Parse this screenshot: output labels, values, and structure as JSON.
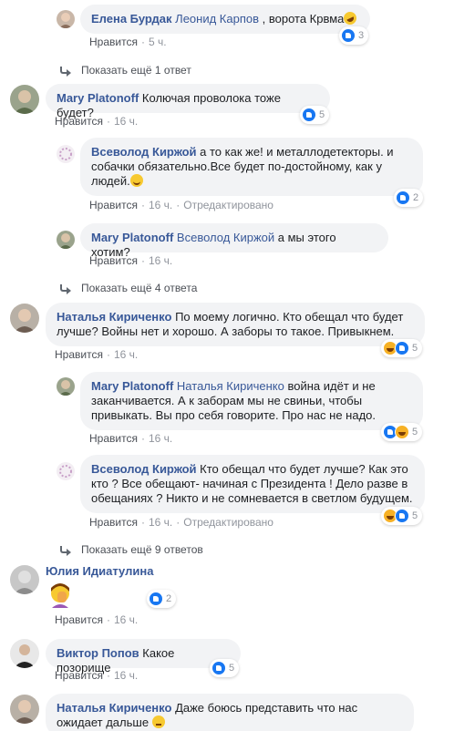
{
  "labels": {
    "like": "Нравится",
    "edited": "Отредактировано",
    "dot": "·"
  },
  "comments": [
    {
      "id": "c1",
      "author": "Елена Бурдак",
      "mention": "Леонид Карпов",
      "text": ", ворота Крвма",
      "emoji": "rofl-emoji",
      "time": "5 ч.",
      "reactions": "3"
    },
    {
      "id": "c2",
      "more": "Показать ещё 1 ответ"
    },
    {
      "id": "c3",
      "author": "Mary Platonoff",
      "text": "Колючая проволока тоже будет?",
      "time": "16 ч.",
      "reactions": "5"
    },
    {
      "id": "c4",
      "author": "Всеволод Киржой",
      "text": "а то как же! и металлодетекторы. и собачки обязательно.Все будет по-достойному, как у людей.",
      "emoji": "smile-emoji",
      "time": "16 ч.",
      "edited": true,
      "reactions": "2"
    },
    {
      "id": "c5",
      "author": "Mary Platonoff",
      "mention": "Всеволод Киржой",
      "text": "а мы этого хотим?",
      "time": "16 ч."
    },
    {
      "id": "c6",
      "more": "Показать ещё 4 ответа"
    },
    {
      "id": "c7",
      "author": "Наталья Кириченко",
      "text": "По моему логично. Кто обещал что будет лучше? Войны нет и хорошо. А заборы то такое. Привыкнем.",
      "time": "16 ч.",
      "reactions": "5"
    },
    {
      "id": "c8",
      "author": "Mary Platonoff",
      "mention": "Наталья Кириченко",
      "text": "война идёт и не заканчивается. А к заборам мы не свиньи, чтобы привыкать. Вы про себя говорите. Про нас не надо.",
      "time": "16 ч.",
      "reactions": "5"
    },
    {
      "id": "c9",
      "author": "Всеволод Киржой",
      "text": "Кто обещал что будет лучше? Как это кто ? Все обещают- начиная с Президента ! Дело разве в обещаниях ? Никто и не сомневается в светлом будущем.",
      "time": "16 ч.",
      "edited": true,
      "reactions": "5"
    },
    {
      "id": "c10",
      "more": "Показать ещё 9 ответов"
    },
    {
      "id": "c11",
      "author": "Юлия Идиатулина",
      "sticker": "facepalm-sticker",
      "time": "16 ч.",
      "reactions": "2"
    },
    {
      "id": "c12",
      "author": "Виктор Попов",
      "text": "Какое позорище",
      "time": "16 ч.",
      "reactions": "5"
    },
    {
      "id": "c13",
      "author": "Наталья Кириченко",
      "text": "Даже боюсь представить что нас ожидает дальше",
      "emoji": "thinking-emoji"
    }
  ]
}
